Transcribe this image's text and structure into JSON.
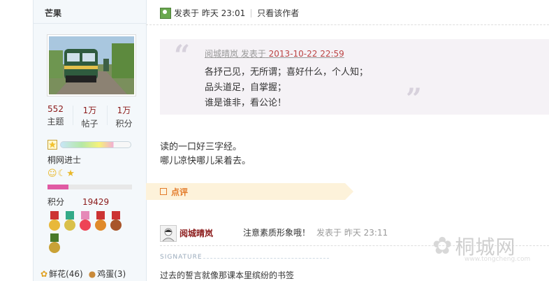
{
  "sidebar": {
    "author": "芒果",
    "stats": [
      {
        "num": "552",
        "label": "主题"
      },
      {
        "num": "1万",
        "label": "帖子"
      },
      {
        "num": "1万",
        "label": "积分"
      }
    ],
    "rank": "桐网进士",
    "points_label": "积分",
    "points_value": "19429",
    "gifts": [
      {
        "icon": "flower-icon",
        "text": "鲜花(46)"
      },
      {
        "icon": "egg-icon",
        "text": "鸡蛋(3)"
      }
    ]
  },
  "post": {
    "posted_at": "发表于 昨天 23:01",
    "only_author": "只看该作者",
    "quote": {
      "author_meta": "阅城晴岚 发表于",
      "date": "2013-10-22 22:59",
      "lines": [
        "各抒己见，无所谓；喜好什么，个人知；",
        "品头道足，自掌握；",
        "谁是谁非，看公论！"
      ]
    },
    "body": [
      "读的一口好三字经。",
      "哪儿凉快哪儿呆着去。"
    ]
  },
  "comments": {
    "section_label": "点评",
    "items": [
      {
        "author": "阅城晴岚",
        "text": "注意素质形象哦！",
        "time": "发表于 昨天 23:11"
      }
    ]
  },
  "signature": {
    "label": "SIGNATURE",
    "text": "过去的誓言就像那课本里缤纷的书签"
  },
  "watermark": {
    "text": "桐城网",
    "url": "www.tongcheng.com"
  },
  "colors": {
    "accent_red": "#8b1a1a",
    "dianping_orange": "#e37b2a",
    "sidebar_bg": "#f4f8fb"
  }
}
